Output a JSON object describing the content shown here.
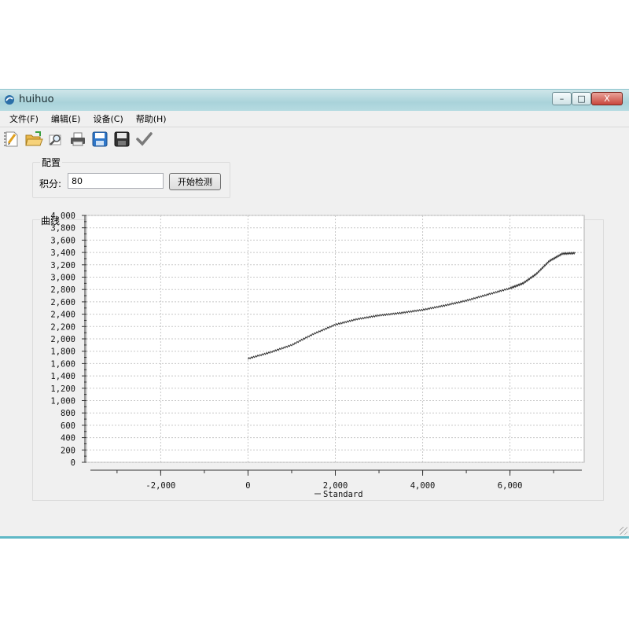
{
  "window": {
    "title": "huihuo",
    "buttons": {
      "minimize": "–",
      "maximize": "□",
      "close": "X"
    }
  },
  "menu": [
    {
      "label": "文件(F)"
    },
    {
      "label": "编辑(E)"
    },
    {
      "label": "设备(C)"
    },
    {
      "label": "帮助(H)"
    }
  ],
  "toolbar": {
    "icons": [
      "new-document-icon",
      "open-folder-icon",
      "print-preview-icon",
      "printer-icon",
      "save-as-icon",
      "save-icon",
      "check-icon"
    ]
  },
  "config": {
    "title": "配置",
    "integral_label": "积分:",
    "integral_value": "80",
    "start_button": "开始检测"
  },
  "curve": {
    "title": "曲线"
  },
  "chart_data": {
    "type": "line",
    "title": "",
    "xlabel": "",
    "ylabel": "",
    "xlim": [
      -3700,
      7700
    ],
    "ylim": [
      0,
      4000
    ],
    "x_ticks": [
      -2000,
      0,
      2000,
      4000,
      6000
    ],
    "x_tick_labels": [
      "-2,000",
      "0",
      "2,000",
      "4,000",
      "6,000"
    ],
    "y_ticks": [
      0,
      200,
      400,
      600,
      800,
      1000,
      1200,
      1400,
      1600,
      1800,
      2000,
      2200,
      2400,
      2600,
      2800,
      3000,
      3200,
      3400,
      3600,
      3800,
      4000
    ],
    "y_tick_labels": [
      "0",
      "200",
      "400",
      "600",
      "800",
      "1,000",
      "1,200",
      "1,400",
      "1,600",
      "1,800",
      "2,000",
      "2,200",
      "2,400",
      "2,600",
      "2,800",
      "3,000",
      "3,200",
      "3,400",
      "3,600",
      "3,800",
      "4,000"
    ],
    "grid": true,
    "legend": "bottom-center",
    "series": [
      {
        "name": "Standard",
        "color": "#333333",
        "x": [
          0,
          500,
          1000,
          1500,
          2000,
          2500,
          3000,
          3500,
          4000,
          4500,
          5000,
          5500,
          6000,
          6300,
          6600,
          6900,
          7200,
          7500
        ],
        "y": [
          1680,
          1780,
          1900,
          2080,
          2230,
          2320,
          2380,
          2420,
          2470,
          2540,
          2620,
          2720,
          2820,
          2900,
          3050,
          3260,
          3380,
          3390
        ]
      }
    ]
  }
}
